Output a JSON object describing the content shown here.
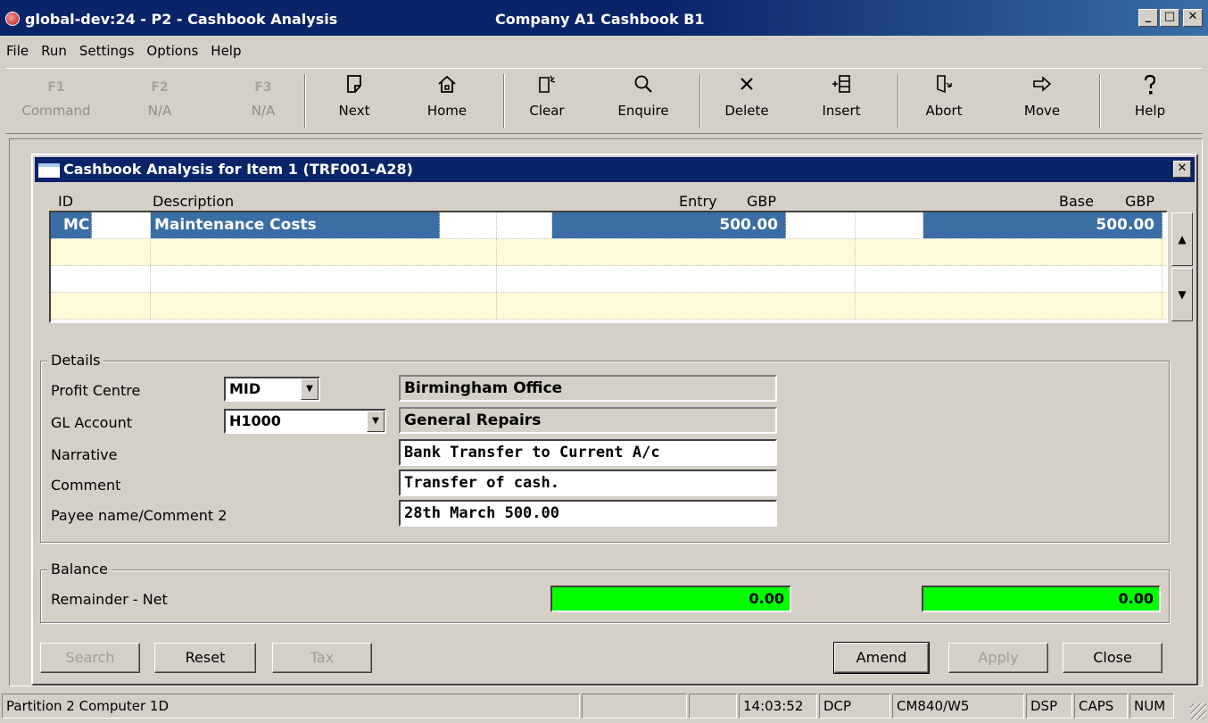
{
  "window": {
    "title": "global-dev:24 - P2 - Cashbook Analysis",
    "context": "Company A1  Cashbook B1",
    "minimize": "_",
    "maximize": "□",
    "close": "✕"
  },
  "menu": [
    "File",
    "Run",
    "Settings",
    "Options",
    "Help"
  ],
  "toolbar": [
    {
      "label": "Command",
      "icon": "F1",
      "enabled": false
    },
    {
      "label": "N/A",
      "icon": "F2",
      "enabled": false
    },
    {
      "label": "N/A",
      "icon": "F3",
      "enabled": false
    },
    {
      "label": "Next",
      "icon": "next-page-icon",
      "enabled": true
    },
    {
      "label": "Home",
      "icon": "home-icon",
      "enabled": true
    },
    {
      "label": "Clear",
      "icon": "clear-icon",
      "enabled": true
    },
    {
      "label": "Enquire",
      "icon": "magnifier-icon",
      "enabled": true
    },
    {
      "label": "Delete",
      "icon": "delete-x-icon",
      "enabled": true
    },
    {
      "label": "Insert",
      "icon": "insert-icon",
      "enabled": true
    },
    {
      "label": "Abort",
      "icon": "abort-door-icon",
      "enabled": true
    },
    {
      "label": "Move",
      "icon": "arrow-right-icon",
      "enabled": true
    },
    {
      "label": "Help",
      "icon": "help-icon",
      "enabled": true
    }
  ],
  "dialog": {
    "title": "Cashbook Analysis for Item    1 (TRF001-A28)",
    "close": "✕",
    "grid": {
      "headers": {
        "id": "ID",
        "description": "Description",
        "entry": "Entry",
        "entry_currency": "GBP",
        "base": "Base",
        "base_currency": "GBP"
      },
      "rows": [
        {
          "id": "MC",
          "description": "Maintenance Costs",
          "entry": "500.00",
          "base": "500.00",
          "selected": true
        }
      ],
      "scroll_up": "▲",
      "scroll_down": "▼"
    },
    "details": {
      "label": "Details",
      "profit_centre": {
        "label": "Profit Centre",
        "code": "MID",
        "name": "Birmingham Office"
      },
      "gl_account": {
        "label": "GL Account",
        "code": "H1000",
        "name": "General Repairs"
      },
      "narrative": {
        "label": "Narrative",
        "value": "Bank Transfer to Current A/c"
      },
      "comment": {
        "label": "Comment",
        "value": "Transfer of cash."
      },
      "payee": {
        "label": "Payee name/Comment 2",
        "value": "28th March 500.00"
      }
    },
    "balance": {
      "label": "Balance",
      "remainder_label": "Remainder - Net",
      "entry_value": "0.00",
      "base_value": "0.00",
      "color": "#00ff00"
    },
    "buttons": {
      "search": "Search",
      "reset": "Reset",
      "tax": "Tax",
      "amend": "Amend",
      "apply": "Apply",
      "close": "Close"
    }
  },
  "status": {
    "partition": "Partition 2 Computer 1D",
    "time": "14:03:52",
    "mode": "DCP",
    "terminal": "CM840/W5",
    "dsp": "DSP",
    "caps": "CAPS",
    "num": "NUM"
  }
}
